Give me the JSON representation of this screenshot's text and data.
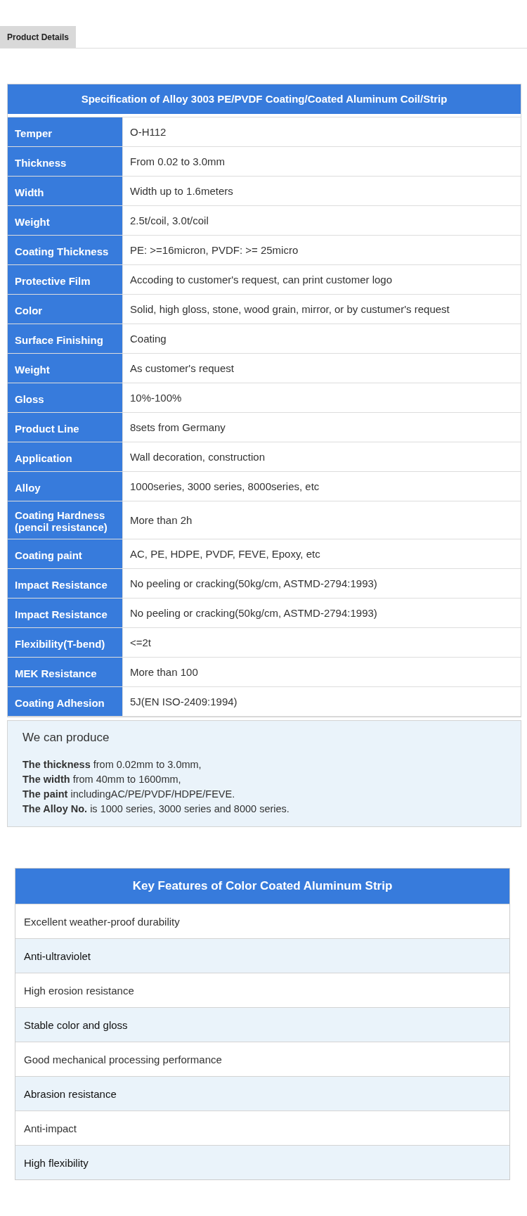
{
  "tab": {
    "label": "Product Details",
    "selected": true
  },
  "spec_table": {
    "title": "Specification of Alloy 3003 PE/PVDF Coating/Coated Aluminum Coil/Strip",
    "rows": [
      {
        "label": "Temper",
        "value": "O-H112"
      },
      {
        "label": "Thickness",
        "value": "From 0.02 to 3.0mm"
      },
      {
        "label": "Width",
        "value": "Width up to 1.6meters"
      },
      {
        "label": "Weight",
        "value": "2.5t/coil, 3.0t/coil"
      },
      {
        "label": "Coating Thickness",
        "value": "PE: >=16micron, PVDF: >= 25micro"
      },
      {
        "label": "Protective Film",
        "value": "Accoding to customer's request, can print customer logo"
      },
      {
        "label": "Color",
        "value": "Solid, high gloss, stone, wood grain, mirror, or by custumer's request"
      },
      {
        "label": "Surface Finishing",
        "value": "Coating"
      },
      {
        "label": "Weight",
        "value": "As customer's request"
      },
      {
        "label": "Gloss",
        "value": "10%-100%"
      },
      {
        "label": "Product Line",
        "value": "8sets from Germany"
      },
      {
        "label": "Application",
        "value": "Wall decoration, construction"
      },
      {
        "label": "Alloy",
        "value": "1000series, 3000 series, 8000series, etc"
      },
      {
        "label": "Coating Hardness (pencil resistance)",
        "value": "More than 2h"
      },
      {
        "label": "Coating paint",
        "value": "AC, PE, HDPE, PVDF, FEVE, Epoxy, etc"
      },
      {
        "label": "Impact Resistance",
        "value": "No peeling or cracking(50kg/cm, ASTMD-2794:1993)"
      },
      {
        "label": "Impact Resistance",
        "value": "No peeling or cracking(50kg/cm, ASTMD-2794:1993)"
      },
      {
        "label": "Flexibility(T-bend)",
        "value": "<=2t"
      },
      {
        "label": "MEK Resistance",
        "value": "More than 100"
      },
      {
        "label": "Coating Adhesion",
        "value": "5J(EN ISO-2409:1994)"
      }
    ]
  },
  "produce": {
    "heading": "We can produce",
    "lines": [
      "**The thickness** from 0.02mm to 3.0mm,",
      "**The width** from 40mm to 1600mm,",
      "**The paint** includingAC/PE/PVDF/HDPE/FEVE.",
      "**The Alloy No.** is 1000 series, 3000 series and 8000 series."
    ]
  },
  "features_table": {
    "title": "Key Features of Color Coated Aluminum Strip",
    "rows": [
      "Excellent weather-proof durability",
      "Anti-ultraviolet",
      "High erosion resistance",
      "Stable color and gloss",
      "Good mechanical processing performance",
      "Abrasion resistance",
      "Anti-impact",
      "High flexibility"
    ]
  }
}
